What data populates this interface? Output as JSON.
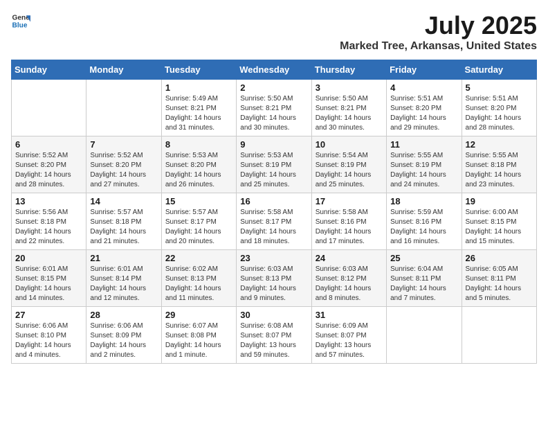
{
  "logo": {
    "text_general": "General",
    "text_blue": "Blue"
  },
  "title": "July 2025",
  "subtitle": "Marked Tree, Arkansas, United States",
  "days_of_week": [
    "Sunday",
    "Monday",
    "Tuesday",
    "Wednesday",
    "Thursday",
    "Friday",
    "Saturday"
  ],
  "weeks": [
    [
      {
        "day": "",
        "info": ""
      },
      {
        "day": "",
        "info": ""
      },
      {
        "day": "1",
        "info": "Sunrise: 5:49 AM\nSunset: 8:21 PM\nDaylight: 14 hours and 31 minutes."
      },
      {
        "day": "2",
        "info": "Sunrise: 5:50 AM\nSunset: 8:21 PM\nDaylight: 14 hours and 30 minutes."
      },
      {
        "day": "3",
        "info": "Sunrise: 5:50 AM\nSunset: 8:21 PM\nDaylight: 14 hours and 30 minutes."
      },
      {
        "day": "4",
        "info": "Sunrise: 5:51 AM\nSunset: 8:20 PM\nDaylight: 14 hours and 29 minutes."
      },
      {
        "day": "5",
        "info": "Sunrise: 5:51 AM\nSunset: 8:20 PM\nDaylight: 14 hours and 28 minutes."
      }
    ],
    [
      {
        "day": "6",
        "info": "Sunrise: 5:52 AM\nSunset: 8:20 PM\nDaylight: 14 hours and 28 minutes."
      },
      {
        "day": "7",
        "info": "Sunrise: 5:52 AM\nSunset: 8:20 PM\nDaylight: 14 hours and 27 minutes."
      },
      {
        "day": "8",
        "info": "Sunrise: 5:53 AM\nSunset: 8:20 PM\nDaylight: 14 hours and 26 minutes."
      },
      {
        "day": "9",
        "info": "Sunrise: 5:53 AM\nSunset: 8:19 PM\nDaylight: 14 hours and 25 minutes."
      },
      {
        "day": "10",
        "info": "Sunrise: 5:54 AM\nSunset: 8:19 PM\nDaylight: 14 hours and 25 minutes."
      },
      {
        "day": "11",
        "info": "Sunrise: 5:55 AM\nSunset: 8:19 PM\nDaylight: 14 hours and 24 minutes."
      },
      {
        "day": "12",
        "info": "Sunrise: 5:55 AM\nSunset: 8:18 PM\nDaylight: 14 hours and 23 minutes."
      }
    ],
    [
      {
        "day": "13",
        "info": "Sunrise: 5:56 AM\nSunset: 8:18 PM\nDaylight: 14 hours and 22 minutes."
      },
      {
        "day": "14",
        "info": "Sunrise: 5:57 AM\nSunset: 8:18 PM\nDaylight: 14 hours and 21 minutes."
      },
      {
        "day": "15",
        "info": "Sunrise: 5:57 AM\nSunset: 8:17 PM\nDaylight: 14 hours and 20 minutes."
      },
      {
        "day": "16",
        "info": "Sunrise: 5:58 AM\nSunset: 8:17 PM\nDaylight: 14 hours and 18 minutes."
      },
      {
        "day": "17",
        "info": "Sunrise: 5:58 AM\nSunset: 8:16 PM\nDaylight: 14 hours and 17 minutes."
      },
      {
        "day": "18",
        "info": "Sunrise: 5:59 AM\nSunset: 8:16 PM\nDaylight: 14 hours and 16 minutes."
      },
      {
        "day": "19",
        "info": "Sunrise: 6:00 AM\nSunset: 8:15 PM\nDaylight: 14 hours and 15 minutes."
      }
    ],
    [
      {
        "day": "20",
        "info": "Sunrise: 6:01 AM\nSunset: 8:15 PM\nDaylight: 14 hours and 14 minutes."
      },
      {
        "day": "21",
        "info": "Sunrise: 6:01 AM\nSunset: 8:14 PM\nDaylight: 14 hours and 12 minutes."
      },
      {
        "day": "22",
        "info": "Sunrise: 6:02 AM\nSunset: 8:13 PM\nDaylight: 14 hours and 11 minutes."
      },
      {
        "day": "23",
        "info": "Sunrise: 6:03 AM\nSunset: 8:13 PM\nDaylight: 14 hours and 9 minutes."
      },
      {
        "day": "24",
        "info": "Sunrise: 6:03 AM\nSunset: 8:12 PM\nDaylight: 14 hours and 8 minutes."
      },
      {
        "day": "25",
        "info": "Sunrise: 6:04 AM\nSunset: 8:11 PM\nDaylight: 14 hours and 7 minutes."
      },
      {
        "day": "26",
        "info": "Sunrise: 6:05 AM\nSunset: 8:11 PM\nDaylight: 14 hours and 5 minutes."
      }
    ],
    [
      {
        "day": "27",
        "info": "Sunrise: 6:06 AM\nSunset: 8:10 PM\nDaylight: 14 hours and 4 minutes."
      },
      {
        "day": "28",
        "info": "Sunrise: 6:06 AM\nSunset: 8:09 PM\nDaylight: 14 hours and 2 minutes."
      },
      {
        "day": "29",
        "info": "Sunrise: 6:07 AM\nSunset: 8:08 PM\nDaylight: 14 hours and 1 minute."
      },
      {
        "day": "30",
        "info": "Sunrise: 6:08 AM\nSunset: 8:07 PM\nDaylight: 13 hours and 59 minutes."
      },
      {
        "day": "31",
        "info": "Sunrise: 6:09 AM\nSunset: 8:07 PM\nDaylight: 13 hours and 57 minutes."
      },
      {
        "day": "",
        "info": ""
      },
      {
        "day": "",
        "info": ""
      }
    ]
  ]
}
